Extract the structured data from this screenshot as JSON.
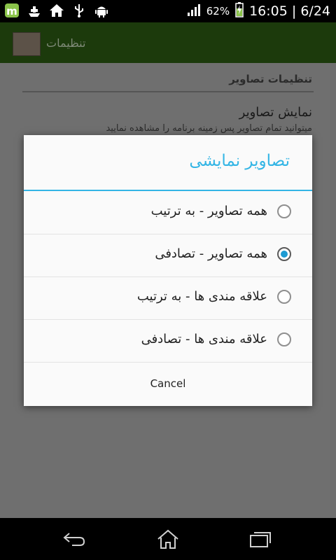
{
  "status_bar": {
    "battery_percent": "62%",
    "time_page": "16:05 | 6/24",
    "icons": [
      "app-m-icon",
      "ship-icon",
      "home-icon",
      "usb-icon",
      "android-icon",
      "signal-icon",
      "battery-icon"
    ]
  },
  "app_bar": {
    "title": "تنظیمات"
  },
  "settings": {
    "section_title": "تنظیمات تصاویر",
    "pref_title": "نمایش تصاویر",
    "pref_summary": "میتوانید تمام تصاویر پس زمینه برنامه را مشاهده نمایید"
  },
  "dialog": {
    "title": "تصاویر نمایشی",
    "options": [
      {
        "label": "همه تصاویر - به ترتیب",
        "selected": false
      },
      {
        "label": "همه تصاویر - تصادفی",
        "selected": true
      },
      {
        "label": "علاقه مندی ها - به ترتیب",
        "selected": false
      },
      {
        "label": "علاقه مندی ها - تصادفی",
        "selected": false
      }
    ],
    "cancel_label": "Cancel"
  },
  "nav_bar": {
    "icons": [
      "back-icon",
      "home-icon",
      "recents-icon"
    ]
  },
  "colors": {
    "accent": "#33b5e5",
    "radio_selected": "#1d9bd3"
  }
}
